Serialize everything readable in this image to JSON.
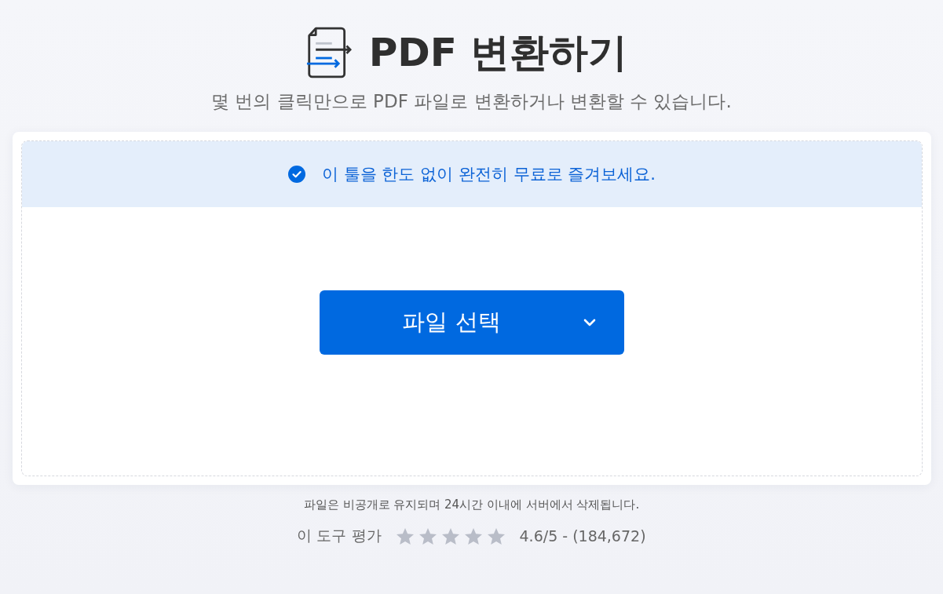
{
  "header": {
    "title": "PDF 변환하기",
    "subtitle": "몇 번의 클릭만으로 PDF 파일로 변환하거나 변환할 수 있습니다."
  },
  "upload_panel": {
    "notice": "이 툴을 한도 없이 완전히 무료로 즐겨보세요.",
    "button": {
      "label": "파일 선택"
    }
  },
  "privacy_note": "파일은 비공개로 유지되며 24시간 이내에 서버에서 삭제됩니다.",
  "rating": {
    "label": "이 도구 평가",
    "stars": 0,
    "score": "4.6/5 - (184,672)"
  }
}
